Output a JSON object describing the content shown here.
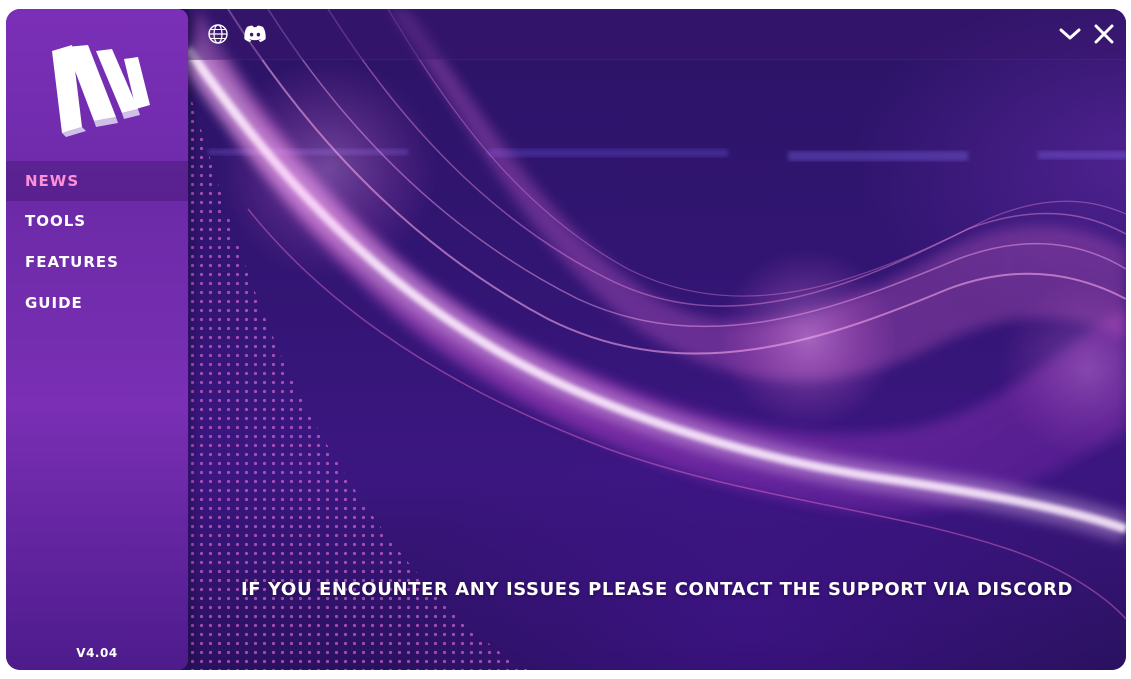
{
  "sidebar": {
    "nav": [
      {
        "label": "NEWS",
        "active": true
      },
      {
        "label": "TOOLS",
        "active": false
      },
      {
        "label": "FEATURES",
        "active": false
      },
      {
        "label": "GUIDE",
        "active": false
      }
    ],
    "version": "V4.04"
  },
  "topbar": {
    "icons": [
      "globe-icon",
      "discord-icon",
      "chevron-down-icon",
      "close-icon"
    ]
  },
  "main": {
    "notice": "IF YOU ENCOUNTER ANY ISSUES PLEASE CONTACT THE SUPPORT VIA DISCORD"
  },
  "colors": {
    "accent": "#ff8fd8",
    "sidebar": "#7b2fb8",
    "background": "#2c1466"
  }
}
